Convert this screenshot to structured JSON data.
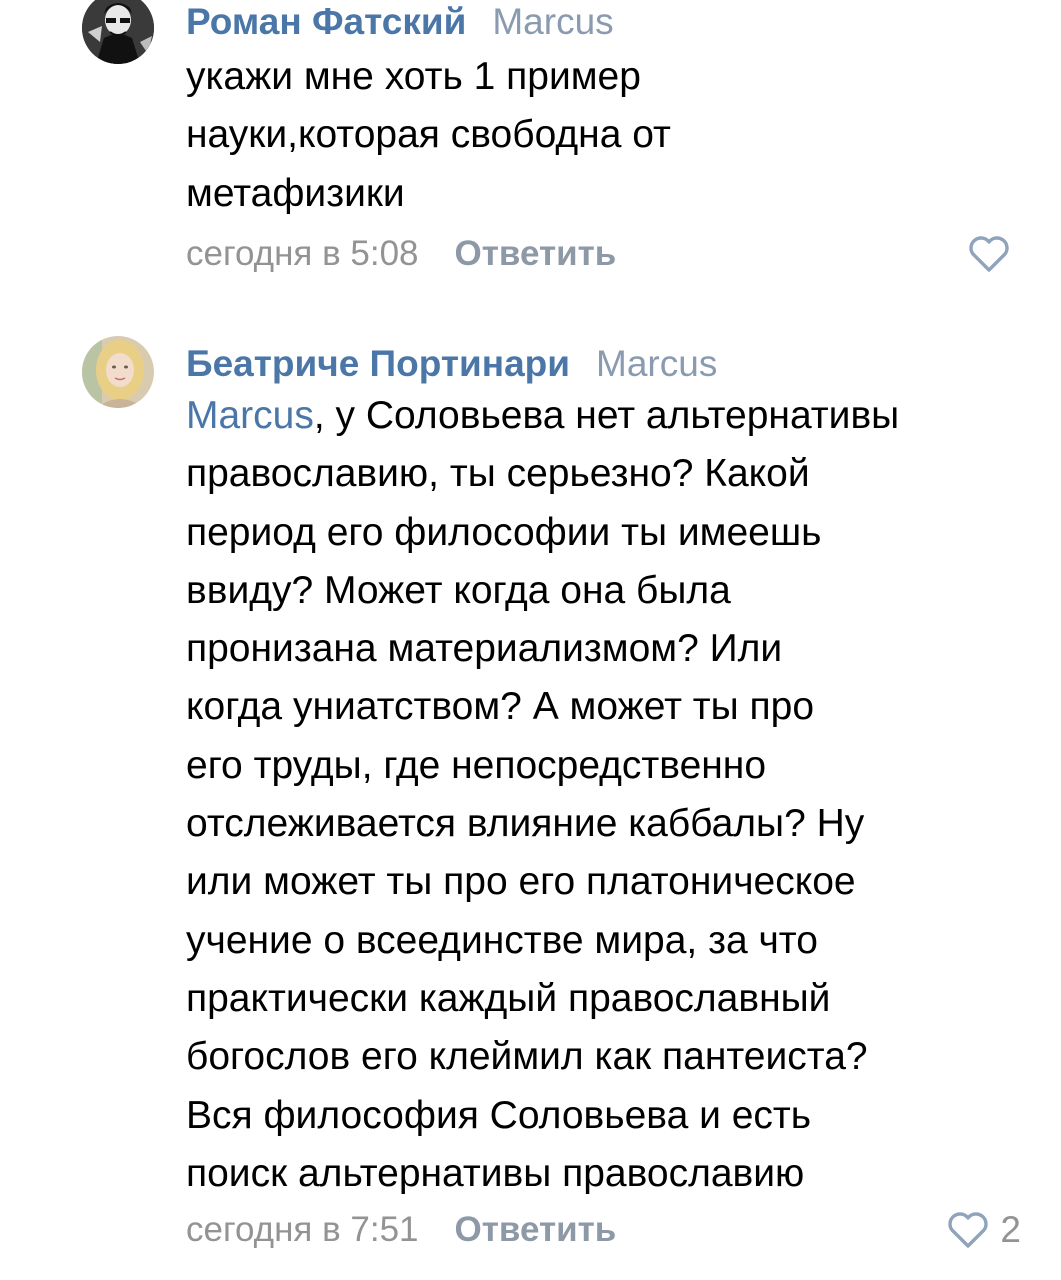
{
  "comments": [
    {
      "author": "Роман Фатский",
      "reply_to": "Marcus",
      "mention": "",
      "text": "укажи мне хоть 1 пример\nнауки,которая свободна от\nметафизики",
      "time": "сегодня в 5:08",
      "reply_label": "Ответить",
      "likes": "",
      "avatar_icon": "bw-portrait-avatar"
    },
    {
      "author": "Беатриче Портинари",
      "reply_to": "Marcus",
      "mention": "Marcus",
      "text": ", у Соловьева нет альтернативы\nправославию, ты серьезно? Какой\nпериод его философии ты имеешь\nввиду? Может когда она была\nпронизана материализмом? Или\nкогда униатством? А может ты про\nего труды, где непосредственно\nотслеживается влияние каббалы? Ну\nили может ты про его платоническое\nучение о всеединстве мира, за что\nпрактически каждый православный\nбогослов его клеймил как пантеиста?\nВся философия Соловьева и есть\nпоиск альтернативы православию",
      "time": "сегодня в 7:51",
      "reply_label": "Ответить",
      "likes": "2",
      "avatar_icon": "woman-portrait-avatar"
    }
  ],
  "colors": {
    "link": "#4a76a8",
    "muted": "#939393",
    "reply_to": "#8a9bb0",
    "heart": "#8fa3bc"
  },
  "icons": {
    "like": "heart-outline-icon"
  }
}
